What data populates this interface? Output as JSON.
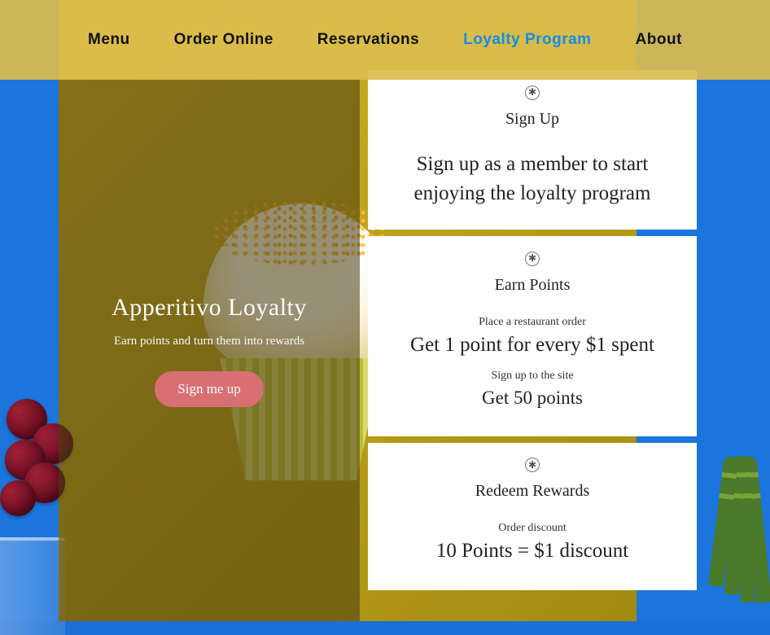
{
  "nav": {
    "items": [
      {
        "label": "Menu",
        "active": false
      },
      {
        "label": "Order Online",
        "active": false
      },
      {
        "label": "Reservations",
        "active": false
      },
      {
        "label": "Loyalty Program",
        "active": true
      },
      {
        "label": "About",
        "active": false
      }
    ]
  },
  "hero": {
    "title": "Apperitivo Loyalty",
    "subtitle": "Earn points and turn them into rewards",
    "button": "Sign me up"
  },
  "cards": {
    "signup": {
      "title": "Sign Up",
      "body": "Sign up as a member to start enjoying the loyalty program"
    },
    "earn": {
      "title": "Earn Points",
      "rules": [
        {
          "sub": "Place a restaurant order",
          "main": "Get 1 point for every $1 spent"
        },
        {
          "sub": "Sign up to the site",
          "main": "Get 50 points"
        }
      ]
    },
    "redeem": {
      "title": "Redeem Rewards",
      "rules": [
        {
          "sub": "Order discount",
          "main": "10 Points = $1 discount"
        }
      ]
    }
  }
}
